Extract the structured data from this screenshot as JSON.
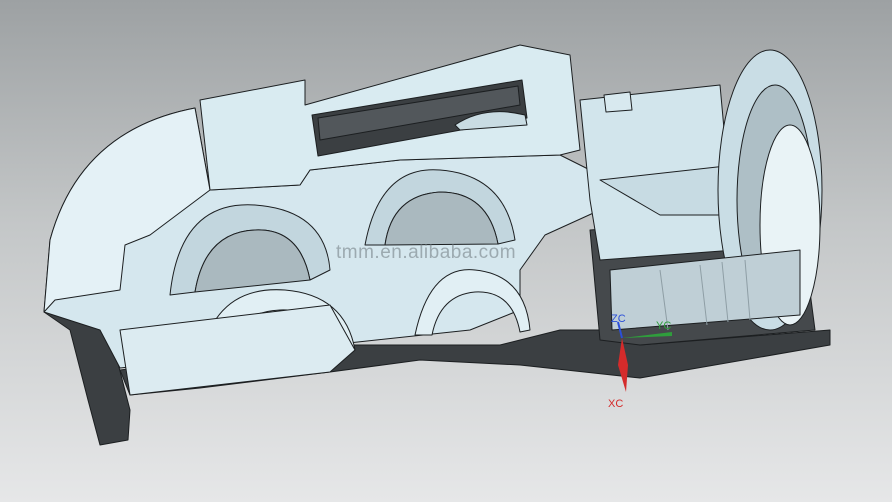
{
  "viewport": {
    "watermark": "tmm.en.alibaba.com",
    "triad": {
      "zc_label": "ZC",
      "yc_label": "YC",
      "xc_label": "XC",
      "zc_color": "#2b4fd8",
      "yc_color": "#2f9e3c",
      "xc_color": "#d42b2b"
    },
    "colors": {
      "part_face": "#d5e7ee",
      "part_light": "#e4f1f6",
      "part_shadow": "#3b3f42",
      "part_edge": "#1c1f21"
    }
  }
}
